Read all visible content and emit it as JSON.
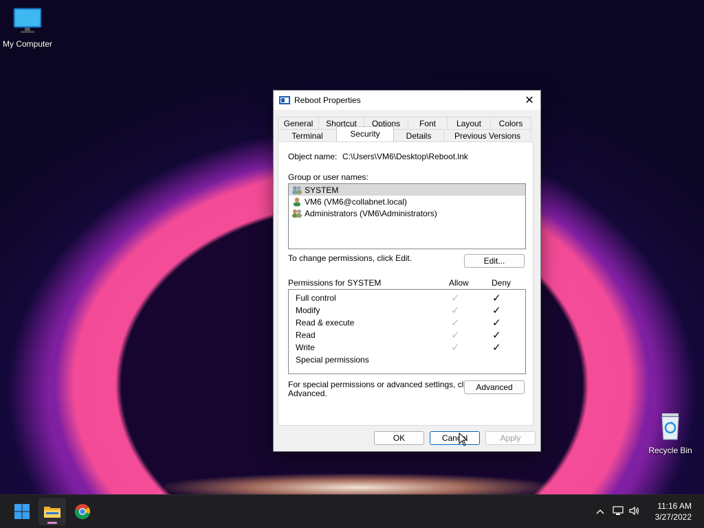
{
  "desktop": {
    "my_computer_label": "My Computer",
    "recycle_bin_label": "Recycle Bin"
  },
  "dialog": {
    "title": "Reboot Properties",
    "tabs_row1": [
      "General",
      "Shortcut",
      "Options",
      "Font",
      "Layout",
      "Colors"
    ],
    "tabs_row2": [
      "Terminal",
      "Security",
      "Details",
      "Previous Versions"
    ],
    "active_tab": "Security",
    "object_name_label": "Object name:",
    "object_name_value": "C:\\Users\\VM6\\Desktop\\Reboot.lnk",
    "group_label": "Group or user names:",
    "users": [
      {
        "name": "SYSTEM",
        "icon": "user-group-icon"
      },
      {
        "name": "VM6 (VM6@collabnet.local)",
        "icon": "user-icon"
      },
      {
        "name": "Administrators (VM6\\Administrators)",
        "icon": "user-group-icon"
      }
    ],
    "change_perm_text": "To change permissions, click Edit.",
    "edit_button": "Edit...",
    "permissions_for": "Permissions for SYSTEM",
    "allow_header": "Allow",
    "deny_header": "Deny",
    "permissions": [
      {
        "name": "Full control",
        "allow": "✓",
        "deny": "✓"
      },
      {
        "name": "Modify",
        "allow": "✓",
        "deny": "✓"
      },
      {
        "name": "Read & execute",
        "allow": "✓",
        "deny": "✓"
      },
      {
        "name": "Read",
        "allow": "✓",
        "deny": "✓"
      },
      {
        "name": "Write",
        "allow": "✓",
        "deny": "✓"
      },
      {
        "name": "Special permissions",
        "allow": "",
        "deny": ""
      }
    ],
    "special_text_line1": "For special permissions or advanced settings, click",
    "special_text_line2": "Advanced.",
    "advanced_button": "Advanced",
    "ok_button": "OK",
    "cancel_button": "Cancel",
    "apply_button": "Apply"
  },
  "taskbar": {
    "time": "11:16 AM",
    "date": "3/27/2022"
  },
  "colors": {
    "accent": "#0067c0",
    "taskbar": "#1f1f22"
  }
}
